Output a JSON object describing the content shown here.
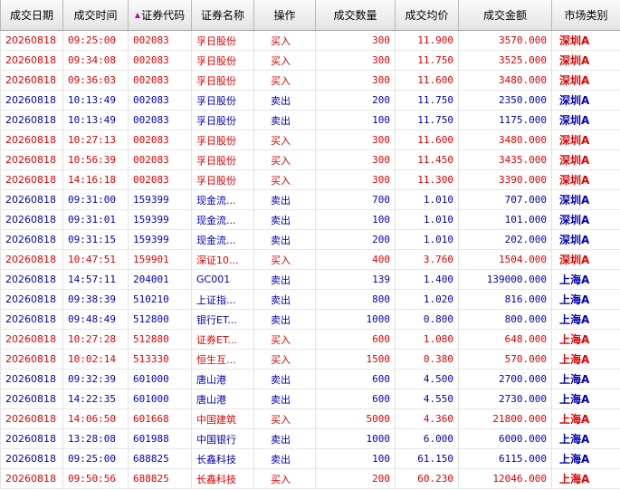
{
  "headers": [
    "成交日期",
    "成交时间",
    "证券代码",
    "证券名称",
    "操作",
    "成交数量",
    "成交均价",
    "成交金额",
    "市场类别"
  ],
  "sorted_column": 2,
  "colors": {
    "buy": "#e00000",
    "sell": "#0000b4",
    "sort_indicator": "#c000c0"
  },
  "rows": [
    {
      "date": "20260818",
      "time": "09:25:00",
      "code": "002083",
      "name": "孚日股份",
      "op": "买入",
      "qty": "300",
      "price": "11.900",
      "amount": "3570.000",
      "market": "深圳A",
      "side": "buy"
    },
    {
      "date": "20260818",
      "time": "09:34:08",
      "code": "002083",
      "name": "孚日股份",
      "op": "买入",
      "qty": "300",
      "price": "11.750",
      "amount": "3525.000",
      "market": "深圳A",
      "side": "buy"
    },
    {
      "date": "20260818",
      "time": "09:36:03",
      "code": "002083",
      "name": "孚日股份",
      "op": "买入",
      "qty": "300",
      "price": "11.600",
      "amount": "3480.000",
      "market": "深圳A",
      "side": "buy"
    },
    {
      "date": "20260818",
      "time": "10:13:49",
      "code": "002083",
      "name": "孚日股份",
      "op": "卖出",
      "qty": "200",
      "price": "11.750",
      "amount": "2350.000",
      "market": "深圳A",
      "side": "sell"
    },
    {
      "date": "20260818",
      "time": "10:13:49",
      "code": "002083",
      "name": "孚日股份",
      "op": "卖出",
      "qty": "100",
      "price": "11.750",
      "amount": "1175.000",
      "market": "深圳A",
      "side": "sell"
    },
    {
      "date": "20260818",
      "time": "10:27:13",
      "code": "002083",
      "name": "孚日股份",
      "op": "买入",
      "qty": "300",
      "price": "11.600",
      "amount": "3480.000",
      "market": "深圳A",
      "side": "buy"
    },
    {
      "date": "20260818",
      "time": "10:56:39",
      "code": "002083",
      "name": "孚日股份",
      "op": "买入",
      "qty": "300",
      "price": "11.450",
      "amount": "3435.000",
      "market": "深圳A",
      "side": "buy"
    },
    {
      "date": "20260818",
      "time": "14:16:18",
      "code": "002083",
      "name": "孚日股份",
      "op": "买入",
      "qty": "300",
      "price": "11.300",
      "amount": "3390.000",
      "market": "深圳A",
      "side": "buy"
    },
    {
      "date": "20260818",
      "time": "09:31:00",
      "code": "159399",
      "name": "现金流...",
      "op": "卖出",
      "qty": "700",
      "price": "1.010",
      "amount": "707.000",
      "market": "深圳A",
      "side": "sell"
    },
    {
      "date": "20260818",
      "time": "09:31:01",
      "code": "159399",
      "name": "现金流...",
      "op": "卖出",
      "qty": "100",
      "price": "1.010",
      "amount": "101.000",
      "market": "深圳A",
      "side": "sell"
    },
    {
      "date": "20260818",
      "time": "09:31:15",
      "code": "159399",
      "name": "现金流...",
      "op": "卖出",
      "qty": "200",
      "price": "1.010",
      "amount": "202.000",
      "market": "深圳A",
      "side": "sell"
    },
    {
      "date": "20260818",
      "time": "10:47:51",
      "code": "159901",
      "name": "深证10...",
      "op": "买入",
      "qty": "400",
      "price": "3.760",
      "amount": "1504.000",
      "market": "深圳A",
      "side": "buy"
    },
    {
      "date": "20260818",
      "time": "14:57:11",
      "code": "204001",
      "name": "GC001",
      "op": "卖出",
      "qty": "139",
      "price": "1.400",
      "amount": "139000.000",
      "market": "上海A",
      "side": "sell"
    },
    {
      "date": "20260818",
      "time": "09:38:39",
      "code": "510210",
      "name": "上证指...",
      "op": "卖出",
      "qty": "800",
      "price": "1.020",
      "amount": "816.000",
      "market": "上海A",
      "side": "sell"
    },
    {
      "date": "20260818",
      "time": "09:48:49",
      "code": "512800",
      "name": "银行ET...",
      "op": "卖出",
      "qty": "1000",
      "price": "0.800",
      "amount": "800.000",
      "market": "上海A",
      "side": "sell"
    },
    {
      "date": "20260818",
      "time": "10:27:28",
      "code": "512880",
      "name": "证券ET...",
      "op": "买入",
      "qty": "600",
      "price": "1.080",
      "amount": "648.000",
      "market": "上海A",
      "side": "buy"
    },
    {
      "date": "20260818",
      "time": "10:02:14",
      "code": "513330",
      "name": "恒生互...",
      "op": "买入",
      "qty": "1500",
      "price": "0.380",
      "amount": "570.000",
      "market": "上海A",
      "side": "buy"
    },
    {
      "date": "20260818",
      "time": "09:32:39",
      "code": "601000",
      "name": "唐山港",
      "op": "卖出",
      "qty": "600",
      "price": "4.500",
      "amount": "2700.000",
      "market": "上海A",
      "side": "sell"
    },
    {
      "date": "20260818",
      "time": "14:22:35",
      "code": "601000",
      "name": "唐山港",
      "op": "卖出",
      "qty": "600",
      "price": "4.550",
      "amount": "2730.000",
      "market": "上海A",
      "side": "sell"
    },
    {
      "date": "20260818",
      "time": "14:06:50",
      "code": "601668",
      "name": "中国建筑",
      "op": "买入",
      "qty": "5000",
      "price": "4.360",
      "amount": "21800.000",
      "market": "上海A",
      "side": "buy"
    },
    {
      "date": "20260818",
      "time": "13:28:08",
      "code": "601988",
      "name": "中国银行",
      "op": "卖出",
      "qty": "1000",
      "price": "6.000",
      "amount": "6000.000",
      "market": "上海A",
      "side": "sell"
    },
    {
      "date": "20260818",
      "time": "09:25:00",
      "code": "688825",
      "name": "长鑫科技",
      "op": "卖出",
      "qty": "100",
      "price": "61.150",
      "amount": "6115.000",
      "market": "上海A",
      "side": "sell"
    },
    {
      "date": "20260818",
      "time": "09:50:56",
      "code": "688825",
      "name": "长鑫科技",
      "op": "买入",
      "qty": "200",
      "price": "60.230",
      "amount": "12046.000",
      "market": "上海A",
      "side": "buy"
    }
  ]
}
